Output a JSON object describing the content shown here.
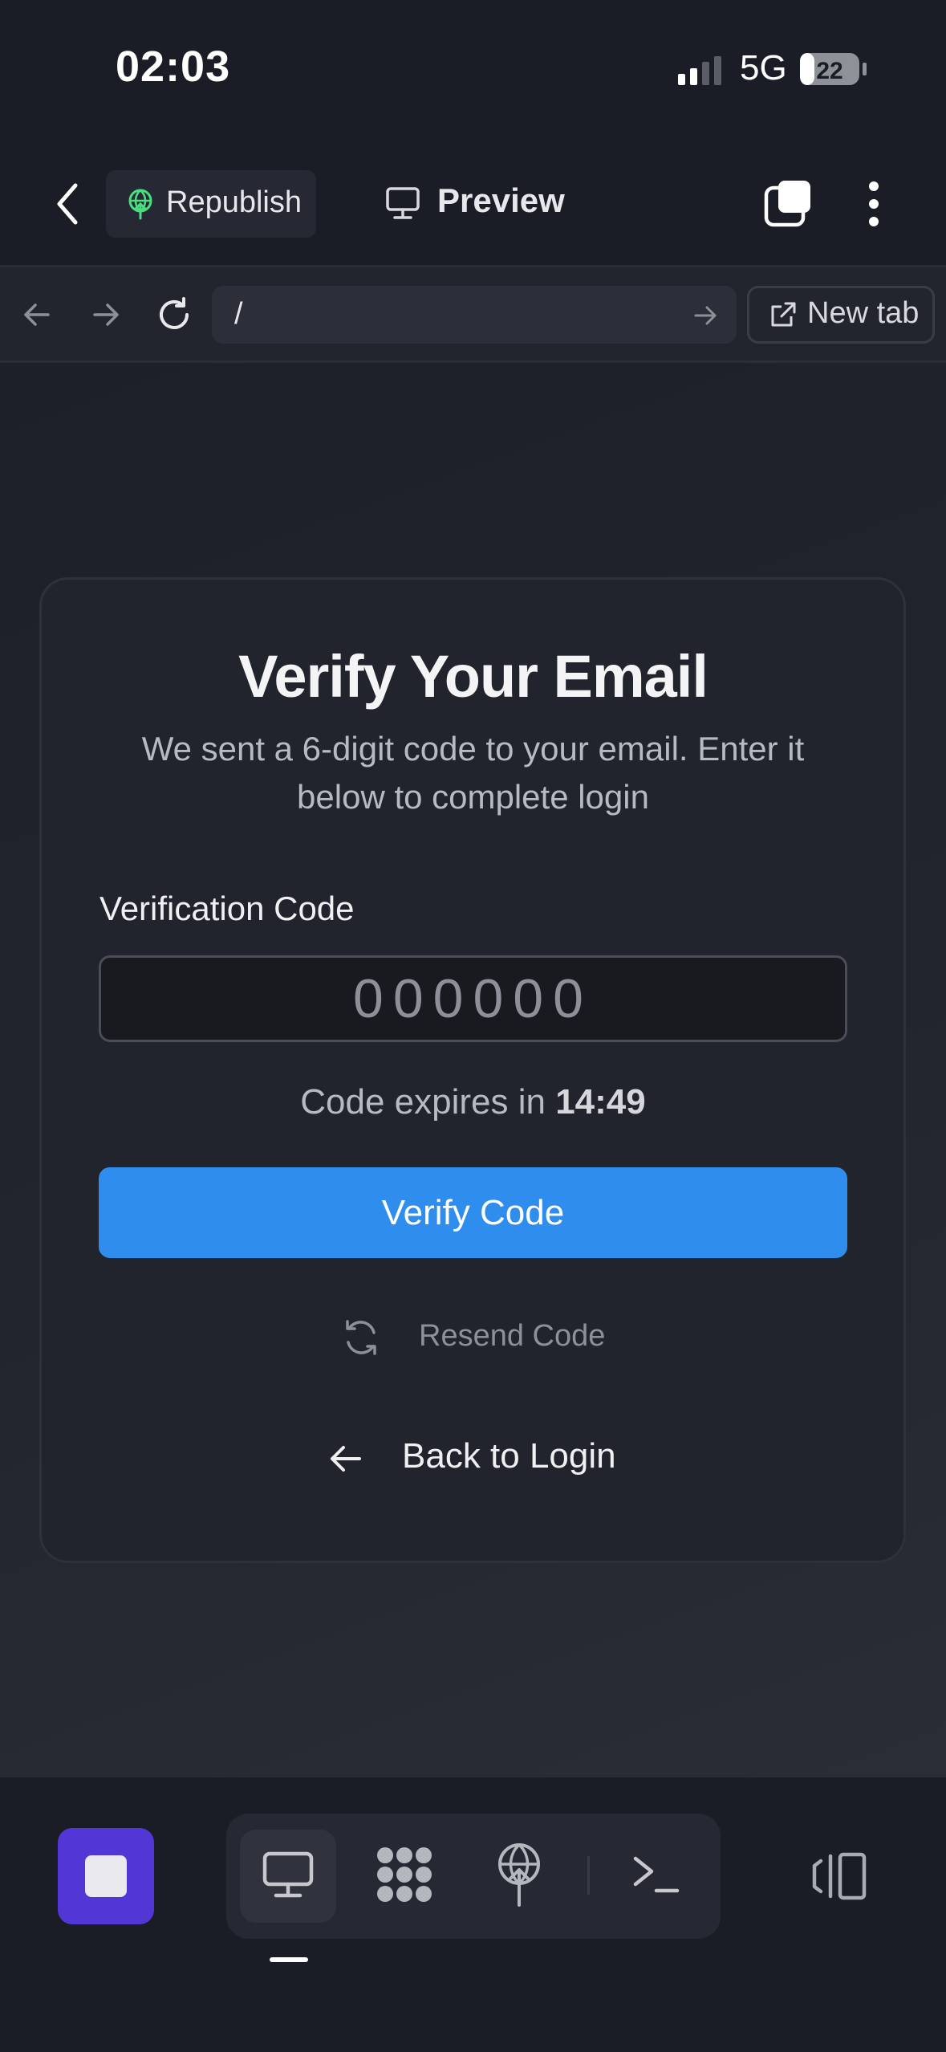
{
  "status_bar": {
    "time": "02:03",
    "network": "5G",
    "battery": "22"
  },
  "app_bar": {
    "republish_label": "Republish",
    "preview_label": "Preview"
  },
  "browser_bar": {
    "url": "/",
    "new_tab_label": "New tab"
  },
  "verify_card": {
    "title": "Verify Your Email",
    "subtitle": "We sent a 6-digit code to your email. Enter it below to complete login",
    "code_label": "Verification Code",
    "code_placeholder": "000000",
    "code_value": "",
    "expires_prefix": "Code expires in",
    "expires_time": "14:49",
    "verify_button": "Verify Code",
    "resend_label": "Resend Code",
    "back_to_login": "Back to Login"
  },
  "colors": {
    "background": "#1b1d26",
    "card": "#21242d",
    "primary_button": "#2f8ded",
    "stop_button": "#5236d6",
    "republish_icon": "#4ade80"
  },
  "icons": {
    "back": "chevron-left-icon",
    "republish": "deploy-globe-icon",
    "preview": "monitor-icon",
    "tabs": "tabs-icon",
    "more": "more-vertical-icon",
    "nav_back": "arrow-left-icon",
    "nav_forward": "arrow-right-icon",
    "reload": "reload-icon",
    "url_go": "arrow-right-icon",
    "new_tab": "external-link-icon",
    "resend": "refresh-icon",
    "back_login": "arrow-left-icon",
    "stop": "stop-icon",
    "desktop": "monitor-icon",
    "apps": "grid-blobs-icon",
    "deploy": "deploy-globe-icon",
    "shell": "terminal-icon",
    "panel": "panel-toggle-icon"
  }
}
